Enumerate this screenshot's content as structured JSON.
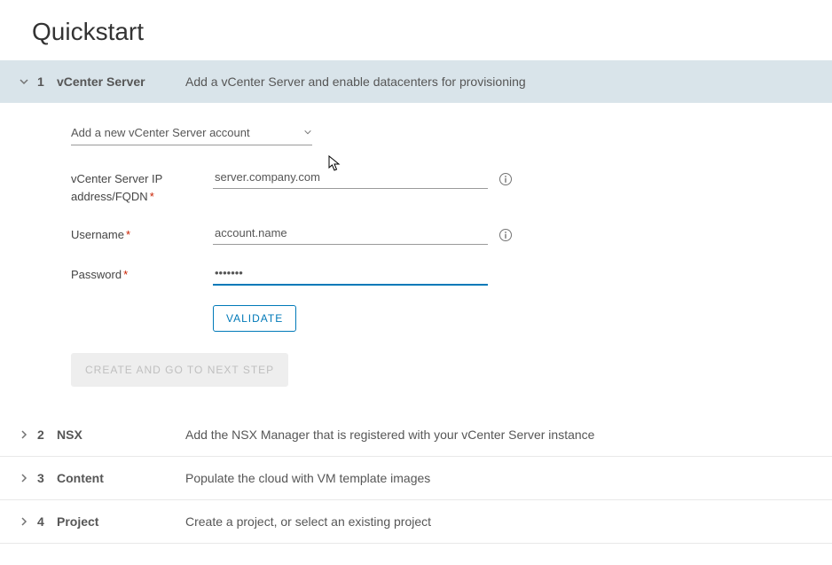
{
  "page": {
    "title": "Quickstart"
  },
  "sections": [
    {
      "number": "1",
      "title": "vCenter Server",
      "description": "Add a vCenter Server and enable datacenters for provisioning",
      "expanded": true
    },
    {
      "number": "2",
      "title": "NSX",
      "description": "Add the NSX Manager that is registered with your vCenter Server instance",
      "expanded": false
    },
    {
      "number": "3",
      "title": "Content",
      "description": "Populate the cloud with VM template images",
      "expanded": false
    },
    {
      "number": "4",
      "title": "Project",
      "description": "Create a project, or select an existing project",
      "expanded": false
    }
  ],
  "form": {
    "dropdown": {
      "selected": "Add a new vCenter Server account"
    },
    "fields": {
      "ip": {
        "label": "vCenter Server IP address/FQDN",
        "value": "server.company.com"
      },
      "username": {
        "label": "Username",
        "value": "account.name"
      },
      "password": {
        "label": "Password",
        "value": "•••••••"
      }
    },
    "buttons": {
      "validate": "VALIDATE",
      "next": "CREATE AND GO TO NEXT STEP"
    }
  }
}
